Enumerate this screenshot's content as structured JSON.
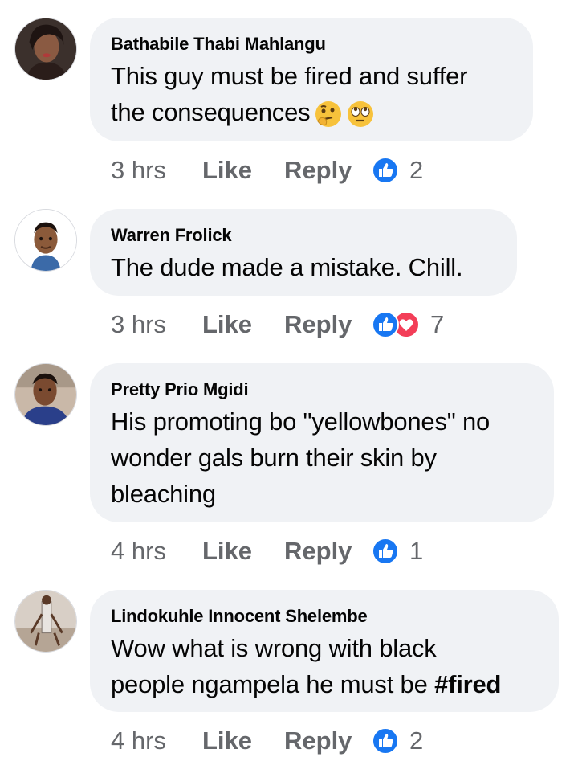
{
  "comments": [
    {
      "author": "Bathabile Thabi Mahlangu",
      "text": "This guy must be fired and suffer the consequences",
      "emojis": [
        "thinking-face-emoji",
        "face-with-rolling-eyes-emoji"
      ],
      "time": "3 hrs",
      "like_label": "Like",
      "reply_label": "Reply",
      "reactions": [
        "like"
      ],
      "reaction_count": "2"
    },
    {
      "author": "Warren Frolick",
      "text": "The dude made a mistake. Chill.",
      "time": "3 hrs",
      "like_label": "Like",
      "reply_label": "Reply",
      "reactions": [
        "like",
        "love"
      ],
      "reaction_count": "7"
    },
    {
      "author": "Pretty Prio Mgidi",
      "text_line1": "His promoting bo \"yellowbones\" no",
      "text_line2": "wonder gals burn their skin by",
      "text_line3": "bleaching",
      "time": "4 hrs",
      "like_label": "Like",
      "reply_label": "Reply",
      "reactions": [
        "like"
      ],
      "reaction_count": "1"
    },
    {
      "author": "Lindokuhle Innocent Shelembe",
      "text_line1": "Wow what is wrong with  black",
      "text_line2_plain": "people ngampela he must be ",
      "text_line2_bold": "#fired",
      "time": "4 hrs",
      "like_label": "Like",
      "reply_label": "Reply",
      "reactions": [
        "like"
      ],
      "reaction_count": "2"
    }
  ],
  "colors": {
    "bubble": "#f0f2f5",
    "like_blue": "#1877f2",
    "love_red": "#f33e58",
    "meta_gray": "#65676b"
  }
}
